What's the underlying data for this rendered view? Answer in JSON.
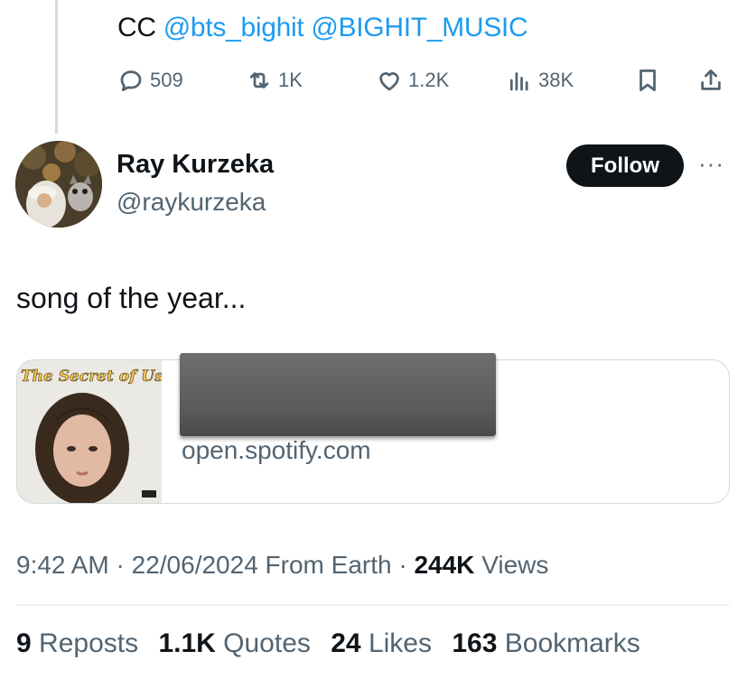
{
  "parent_tweet": {
    "prefix": "CC",
    "mentions": [
      "@bts_bighit",
      "@BIGHIT_MUSIC"
    ],
    "actions": {
      "replies": "509",
      "reposts": "1K",
      "likes": "1.2K",
      "views": "38K"
    }
  },
  "tweet": {
    "author_name": "Ray Kurzeka",
    "author_handle": "@raykurzeka",
    "follow_label": "Follow",
    "more_label": "···",
    "text": "song of the year...",
    "card": {
      "album_title": "The Secret of Us",
      "domain": "open.spotify.com"
    },
    "meta": {
      "time": "9:42 AM",
      "separator": "·",
      "date": "22/06/2024",
      "location": "From Earth",
      "views_count": "244K",
      "views_label": "Views"
    },
    "stats": {
      "reposts_count": "9",
      "reposts_label": "Reposts",
      "quotes_count": "1.1K",
      "quotes_label": "Quotes",
      "likes_count": "24",
      "likes_label": "Likes",
      "bookmarks_count": "163",
      "bookmarks_label": "Bookmarks"
    }
  },
  "colors": {
    "link": "#1d9bf0",
    "text": "#0f1419",
    "secondary": "#536471",
    "border": "#cfd9de",
    "button_bg": "#0f1419"
  },
  "icons": [
    "reply-icon",
    "repost-icon",
    "like-icon",
    "views-icon",
    "bookmark-icon",
    "share-icon",
    "more-icon"
  ]
}
